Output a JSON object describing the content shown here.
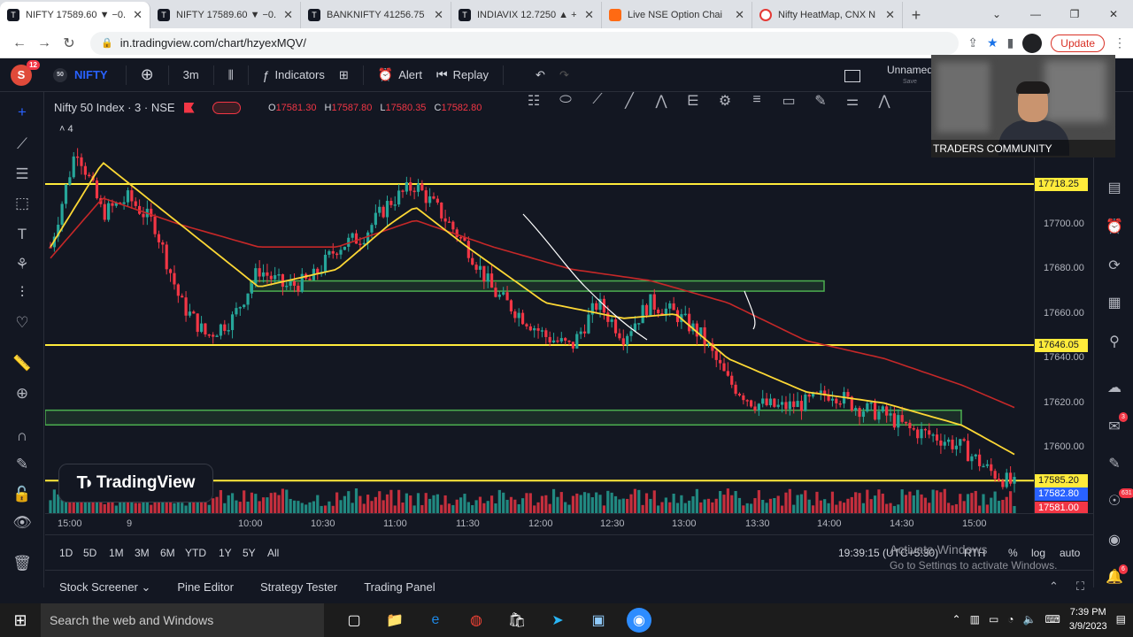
{
  "browser": {
    "tabs": [
      {
        "title": "NIFTY 17589.60 ▼ −0.",
        "icon": "tradingview-icon",
        "active": true
      },
      {
        "title": "NIFTY 17589.60 ▼ −0.",
        "icon": "tradingview-icon"
      },
      {
        "title": "BANKNIFTY 41256.75",
        "icon": "tradingview-icon"
      },
      {
        "title": "INDIAVIX 12.7250 ▲ +",
        "icon": "tradingview-icon"
      },
      {
        "title": "Live NSE Option Chai",
        "icon": "nse-icon"
      },
      {
        "title": "Nifty HeatMap, CNX N",
        "icon": "gauge-icon"
      }
    ],
    "url": "in.tradingview.com/chart/hzyexMQV/",
    "update_label": "Update"
  },
  "tv": {
    "avatar_letter": "S",
    "notif_count": "12",
    "symbol_badge": "50",
    "symbol": "NIFTY",
    "interval": "3m",
    "indicators_label": "Indicators",
    "alert_label": "Alert",
    "replay_label": "Replay",
    "layout_name": "Unnamed",
    "layout_sub": "Save"
  },
  "chart": {
    "title": "Nifty 50 Index · 3 · NSE",
    "ohlc": {
      "o_label": "O",
      "o": "17581.30",
      "h_label": "H",
      "h": "17587.80",
      "l_label": "L",
      "l": "17580.35",
      "c_label": "C",
      "c": "17582.80"
    },
    "indicator_count": "4",
    "watermark": "TradingView"
  },
  "chart_data": {
    "type": "candlestick",
    "ylim": [
      17570,
      17760
    ],
    "y_ticks": [
      "17700.00",
      "17680.00",
      "17660.00",
      "17640.00",
      "17620.00",
      "17600.00"
    ],
    "x_ticks": [
      "15:00",
      "9",
      "10:00",
      "10:30",
      "11:00",
      "11:30",
      "12:00",
      "12:30",
      "13:00",
      "13:30",
      "14:00",
      "14:30",
      "15:00"
    ],
    "horizontal_levels": [
      17718.25,
      17646.05,
      17585.2
    ],
    "price_labels": {
      "level_high": "17718.25",
      "level_mid": "17646.05",
      "level_low": "17585.20",
      "last": "17582.80",
      "bottom": "17581.00"
    },
    "zones": [
      {
        "from": 17671,
        "to": 17674
      },
      {
        "from": 17611,
        "to": 17616
      }
    ],
    "close_path": [
      [
        0,
        17690
      ],
      [
        1,
        17735
      ],
      [
        2,
        17705
      ],
      [
        3,
        17712
      ],
      [
        4,
        17700
      ],
      [
        5,
        17665
      ],
      [
        6,
        17650
      ],
      [
        7,
        17658
      ],
      [
        8,
        17680
      ],
      [
        9,
        17672
      ],
      [
        10,
        17675
      ],
      [
        11,
        17690
      ],
      [
        12,
        17695
      ],
      [
        13,
        17710
      ],
      [
        14,
        17718
      ],
      [
        15,
        17705
      ],
      [
        16,
        17690
      ],
      [
        17,
        17670
      ],
      [
        18,
        17660
      ],
      [
        19,
        17650
      ],
      [
        20,
        17645
      ],
      [
        21,
        17665
      ],
      [
        22,
        17650
      ],
      [
        23,
        17665
      ],
      [
        24,
        17660
      ],
      [
        25,
        17650
      ],
      [
        26,
        17630
      ],
      [
        27,
        17620
      ],
      [
        28,
        17618
      ],
      [
        29,
        17620
      ],
      [
        30,
        17625
      ],
      [
        31,
        17618
      ],
      [
        32,
        17615
      ],
      [
        33,
        17608
      ],
      [
        34,
        17605
      ],
      [
        35,
        17600
      ],
      [
        36,
        17590
      ],
      [
        37,
        17583
      ]
    ],
    "ma_fast": [
      [
        0,
        17690
      ],
      [
        2,
        17728
      ],
      [
        5,
        17700
      ],
      [
        8,
        17672
      ],
      [
        11,
        17680
      ],
      [
        13,
        17700
      ],
      [
        14,
        17708
      ],
      [
        16,
        17690
      ],
      [
        19,
        17665
      ],
      [
        22,
        17658
      ],
      [
        24,
        17660
      ],
      [
        26,
        17640
      ],
      [
        29,
        17625
      ],
      [
        32,
        17620
      ],
      [
        35,
        17610
      ],
      [
        37,
        17597
      ]
    ],
    "ma_slow": [
      [
        0,
        17685
      ],
      [
        2,
        17712
      ],
      [
        5,
        17700
      ],
      [
        8,
        17690
      ],
      [
        11,
        17690
      ],
      [
        14,
        17702
      ],
      [
        17,
        17690
      ],
      [
        20,
        17680
      ],
      [
        23,
        17675
      ],
      [
        26,
        17665
      ],
      [
        29,
        17648
      ],
      [
        32,
        17640
      ],
      [
        35,
        17628
      ],
      [
        37,
        17618
      ]
    ]
  },
  "range": {
    "buttons": [
      "1D",
      "5D",
      "1M",
      "3M",
      "6M",
      "YTD",
      "1Y",
      "5Y",
      "All"
    ],
    "clock": "19:39:15 (UTC+5:30)",
    "rth": "RTH",
    "pct": "%",
    "log": "log",
    "auto": "auto"
  },
  "windows_notice": {
    "line1": "Activate Windows",
    "line2": "Go to Settings to activate Windows."
  },
  "bottom": {
    "stock_screener": "Stock Screener",
    "pine_editor": "Pine Editor",
    "strategy_tester": "Strategy Tester",
    "trading_panel": "Trading Panel"
  },
  "webcam": {
    "caption": "TRADERS COMMUNITY"
  },
  "right_badges": {
    "alerts": "3",
    "chats": "631",
    "ideas": "6"
  },
  "taskbar": {
    "search_placeholder": "Search the web and Windows",
    "time": "7:39 PM",
    "date": "3/9/2023"
  },
  "colors": {
    "up": "#26a69a",
    "down": "#f23645",
    "level": "#ffeb3b",
    "zone": "#4caf50",
    "ma_slow": "#c62828",
    "ma_fast": "#fdd835"
  }
}
